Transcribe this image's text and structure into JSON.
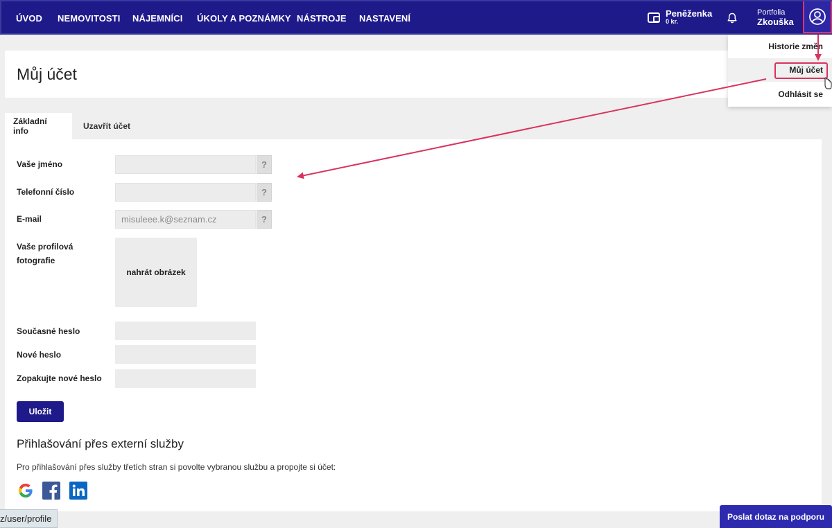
{
  "nav": {
    "items": [
      {
        "label": "ÚVOD"
      },
      {
        "label": "NEMOVITOSTI"
      },
      {
        "label": "NÁJEMNÍCI"
      },
      {
        "label": "ÚKOLY A POZNÁMKY"
      },
      {
        "label": "NÁSTROJE"
      },
      {
        "label": "NASTAVENÍ"
      }
    ]
  },
  "wallet": {
    "title": "Peněženka",
    "balance": "0 kr."
  },
  "portfolio": {
    "label": "Portfolia",
    "name": "Zkouška"
  },
  "user_menu": {
    "items": [
      {
        "label": "Historie změn"
      },
      {
        "label": "Můj účet"
      },
      {
        "label": "Odhlásit se"
      }
    ]
  },
  "page": {
    "title": "Můj účet"
  },
  "tabs": [
    {
      "label": "Základní info"
    },
    {
      "label": "Uzavřít účet"
    }
  ],
  "form": {
    "name_label": "Vaše jméno",
    "name_value": "",
    "phone_label": "Telefonní číslo",
    "phone_value": "",
    "email_label": "E-mail",
    "email_value": "misuleee.k@seznam.cz",
    "help": "?",
    "photo_label": "Vaše profilová fotografie",
    "upload_label": "nahrát obrázek",
    "current_password_label": "Současné heslo",
    "new_password_label": "Nové heslo",
    "repeat_password_label": "Zopakujte nové heslo",
    "save_label": "Uložit"
  },
  "external": {
    "title": "Přihlašování přes externí služby",
    "description": "Pro přihlašování přes služby třetích stran si povolte vybranou službu a propojte si účet:",
    "services": [
      {
        "icon": "google-icon"
      },
      {
        "icon": "facebook-icon"
      },
      {
        "icon": "linkedin-icon"
      }
    ]
  },
  "status_url": "z/user/profile",
  "support_label": "Poslat dotaz na podporu",
  "colors": {
    "primary": "#1f1a8a",
    "annotation": "#d9335f"
  }
}
